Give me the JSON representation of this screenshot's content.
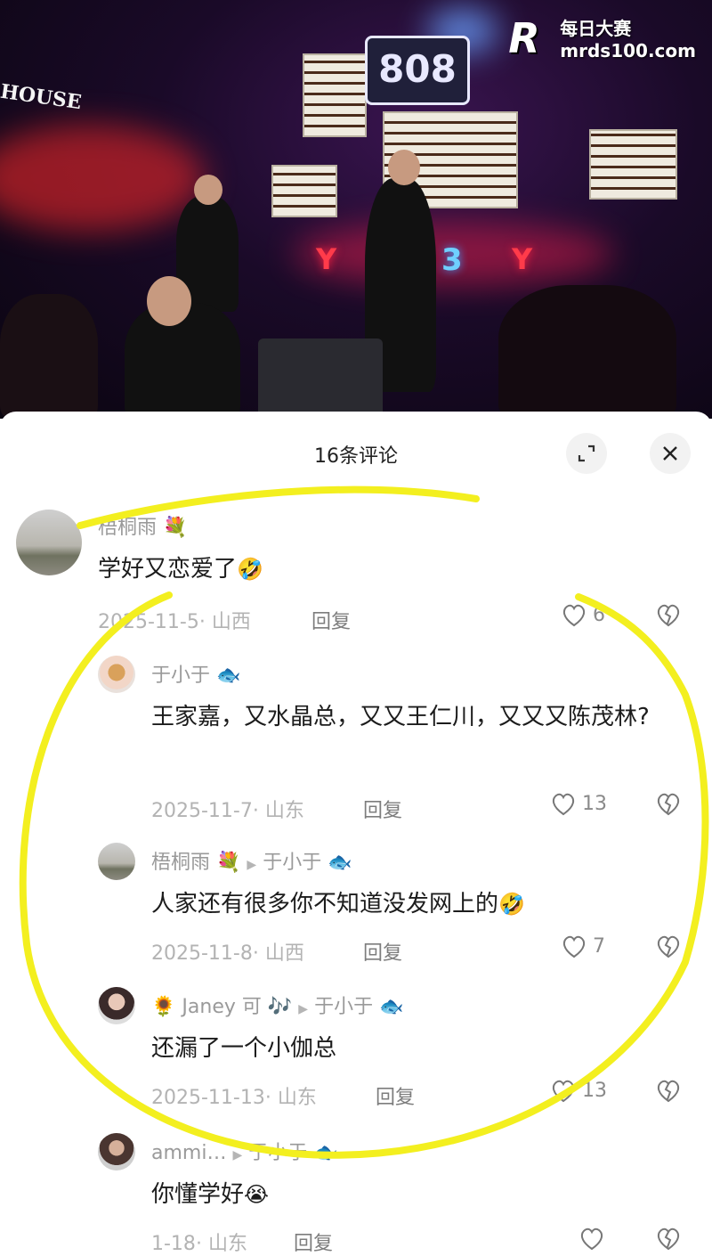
{
  "watermark": {
    "logo_letter": "R",
    "brand": "每日大赛",
    "url": "mrds100.com"
  },
  "scene": {
    "sign_808": "808",
    "house_sign": "HOUSE",
    "neon_left": "Y",
    "neon_mid": "3",
    "neon_right": "Y"
  },
  "panel": {
    "title": "16条评论",
    "expand_icon": "expand-icon",
    "close_icon": "close-icon"
  },
  "comments": [
    {
      "name": "梧桐雨",
      "name_emoji": "💐",
      "text": "学好又恋爱了",
      "text_emoji": "🤣",
      "date": "2025-11-5",
      "region": "山西",
      "reply_label": "回复",
      "likes": "6"
    },
    {
      "name": "于小于",
      "name_emoji": "🐟",
      "text": "王家嘉，又水晶总，又又王仁川，又又又陈茂林?",
      "date": "2025-11-7",
      "region": "山东",
      "reply_label": "回复",
      "likes": "13"
    },
    {
      "name": "梧桐雨",
      "name_emoji": "💐",
      "reply_to": "于小于",
      "reply_to_emoji": "🐟",
      "text": "人家还有很多你不知道没发网上的",
      "text_emoji": "🤣",
      "date": "2025-11-8",
      "region": "山西",
      "reply_label": "回复",
      "likes": "7"
    },
    {
      "name": "Janey 可",
      "name_prefix_emoji": "🌻",
      "name_emoji": "🎶",
      "reply_to": "于小于",
      "reply_to_emoji": "🐟",
      "text": "还漏了一个小伽总",
      "date": "2025-11-13",
      "region": "山东",
      "reply_label": "回复",
      "likes": "13"
    },
    {
      "name": "ammi…",
      "reply_to": "于小于",
      "reply_to_emoji": "🐟",
      "text": "你懂学好",
      "text_emoji": "😭",
      "date": "1-18",
      "region": "山东",
      "reply_label": "回复",
      "likes": ""
    }
  ]
}
